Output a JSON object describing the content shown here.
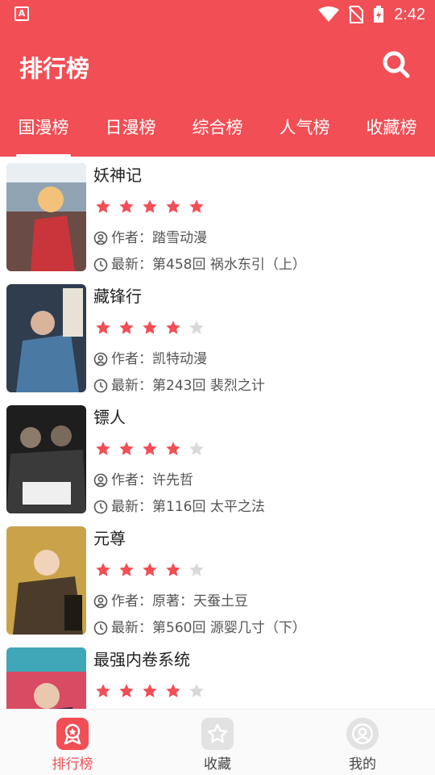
{
  "status_bar": {
    "time": "2:42",
    "app_badge": "A"
  },
  "header": {
    "title": "排行榜"
  },
  "tabs": [
    "国漫榜",
    "日漫榜",
    "综合榜",
    "人气榜",
    "收藏榜"
  ],
  "list": [
    {
      "title": "妖神记",
      "rating": 5,
      "author_label": "作者：踏雪动漫",
      "latest_label": "最新：第458回 祸水东引（上）"
    },
    {
      "title": "藏锋行",
      "rating": 4,
      "author_label": "作者：凯特动漫",
      "latest_label": "最新：第243回 裴烈之计"
    },
    {
      "title": "镖人",
      "rating": 4,
      "author_label": "作者：许先哲",
      "latest_label": "最新：第116回 太平之法"
    },
    {
      "title": "元尊",
      "rating": 4,
      "author_label": "作者：原著：天蚕土豆",
      "latest_label": "最新：第560回 源婴几寸（下）"
    },
    {
      "title": "最强内卷系统",
      "rating": 4,
      "author_label": "",
      "latest_label": ""
    }
  ],
  "bottom_nav": {
    "ranking": "排行榜",
    "favorites": "收藏",
    "mine": "我的"
  },
  "colors": {
    "accent": "#f24e55",
    "star_on": "#f24e55",
    "star_off": "#d9d9d9",
    "text": "#222222",
    "muted": "#555555"
  }
}
